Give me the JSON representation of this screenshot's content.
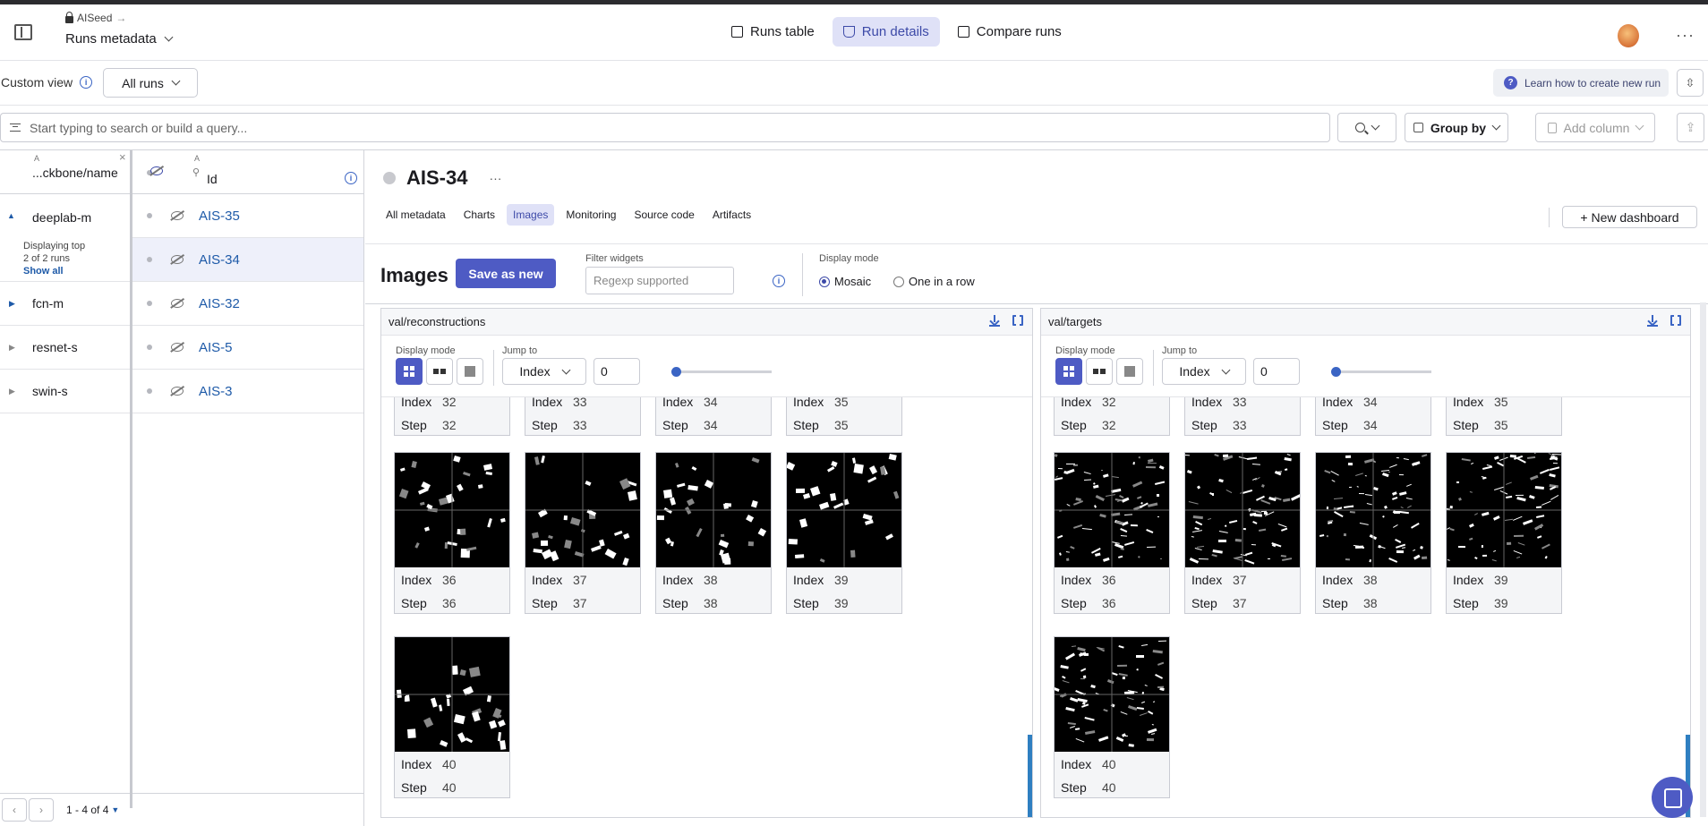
{
  "header": {
    "breadcrumb": "AISeed",
    "project": "Runs metadata",
    "tabs": [
      {
        "label": "Runs table",
        "icon": "table-icon"
      },
      {
        "label": "Run details",
        "icon": "flask-icon"
      },
      {
        "label": "Compare runs",
        "icon": "compare-icon"
      }
    ],
    "more": "···"
  },
  "viewbar": {
    "custom_view": "Custom view",
    "all_runs": "All runs",
    "learn": "Learn how to create new run"
  },
  "querybar": {
    "placeholder": "Start typing to search or build a query...",
    "group_by": "Group by",
    "add_column": "Add column"
  },
  "table": {
    "group_col": "...ckbone/name",
    "id_col": "Id",
    "col_type": "A",
    "groups": [
      {
        "name": "deeplab-m",
        "displaying": "Displaying top",
        "count": "2 of 2 runs",
        "show_all": "Show all"
      },
      {
        "name": "fcn-m"
      },
      {
        "name": "resnet-s"
      },
      {
        "name": "swin-s"
      }
    ],
    "runs": [
      "AIS-35",
      "AIS-34",
      "AIS-32",
      "AIS-5",
      "AIS-3"
    ],
    "pagination": "1 - 4 of 4"
  },
  "run": {
    "title": "AIS-34",
    "more": "···",
    "subtabs": [
      "All metadata",
      "Charts",
      "Images",
      "Monitoring",
      "Source code",
      "Artifacts"
    ],
    "new_dashboard": "+ New dashboard"
  },
  "images": {
    "heading": "Images",
    "save_as_new": "Save as new",
    "filter_label": "Filter widgets",
    "filter_placeholder": "Regexp supported",
    "display_mode_label": "Display mode",
    "mode_mosaic": "Mosaic",
    "mode_row": "One in a row"
  },
  "widgets": [
    {
      "title": "val/reconstructions",
      "display_mode": "Display mode",
      "jump_to": "Jump to",
      "jump_select": "Index",
      "jump_value": "0",
      "index_label": "Index",
      "step_label": "Step",
      "items": [
        "32",
        "33",
        "34",
        "35",
        "36",
        "37",
        "38",
        "39",
        "40"
      ]
    },
    {
      "title": "val/targets",
      "display_mode": "Display mode",
      "jump_to": "Jump to",
      "jump_select": "Index",
      "jump_value": "0",
      "index_label": "Index",
      "step_label": "Step",
      "items": [
        "32",
        "33",
        "34",
        "35",
        "36",
        "37",
        "38",
        "39",
        "40"
      ]
    }
  ],
  "colors": {
    "accent": "#4e5bc4",
    "link": "#1e5aa8",
    "active_tab_bg": "#dfe1f7"
  }
}
